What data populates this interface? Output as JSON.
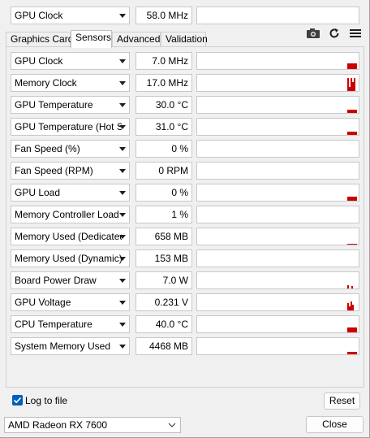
{
  "top_row": {
    "label": "GPU Clock",
    "value": "58.0 MHz"
  },
  "tabs": [
    {
      "label": "Graphics Card"
    },
    {
      "label": "Sensors"
    },
    {
      "label": "Advanced"
    },
    {
      "label": "Validation"
    }
  ],
  "toolbar": {
    "icons": [
      "camera-icon",
      "refresh-icon",
      "menu-icon"
    ]
  },
  "sensors": [
    {
      "label": "GPU Clock",
      "value": "7.0 MHz",
      "spikes": [
        0.4
      ]
    },
    {
      "label": "Memory Clock",
      "value": "17.0 MHz",
      "spikes": [
        0.9,
        0.3,
        0.9,
        0.6,
        0.9
      ]
    },
    {
      "label": "GPU Temperature",
      "value": "30.0 °C",
      "spikes": [
        0.2
      ]
    },
    {
      "label": "GPU Temperature (Hot Spot)",
      "value": "31.0 °C",
      "spikes": [
        0.2
      ]
    },
    {
      "label": "Fan Speed (%)",
      "value": "0 %",
      "spikes": []
    },
    {
      "label": "Fan Speed (RPM)",
      "value": "0 RPM",
      "spikes": []
    },
    {
      "label": "GPU Load",
      "value": "0 %",
      "spikes": [
        0.3
      ]
    },
    {
      "label": "Memory Controller Load",
      "value": "1 %",
      "spikes": []
    },
    {
      "label": "Memory Used (Dedicated)",
      "value": "658 MB",
      "spikes": [
        0.05
      ]
    },
    {
      "label": "Memory Used (Dynamic)",
      "value": "153 MB",
      "spikes": []
    },
    {
      "label": "Board Power Draw",
      "value": "7.0 W",
      "spikes": [
        0.2,
        0.15
      ]
    },
    {
      "label": "GPU Voltage",
      "value": "0.231 V",
      "spikes": [
        0.5,
        0.3,
        0.6,
        0.4
      ]
    },
    {
      "label": "CPU Temperature",
      "value": "40.0 °C",
      "spikes": [
        0.35
      ]
    },
    {
      "label": "System Memory Used",
      "value": "4468 MB",
      "spikes": [
        0.15
      ]
    }
  ],
  "footer": {
    "log_to_file_label": "Log to file",
    "log_to_file_checked": true,
    "reset_label": "Reset",
    "gpu_select_value": "AMD Radeon RX 7600",
    "close_label": "Close"
  },
  "colors": {
    "graph_line": "#cc0000",
    "accent": "#005fb8"
  }
}
